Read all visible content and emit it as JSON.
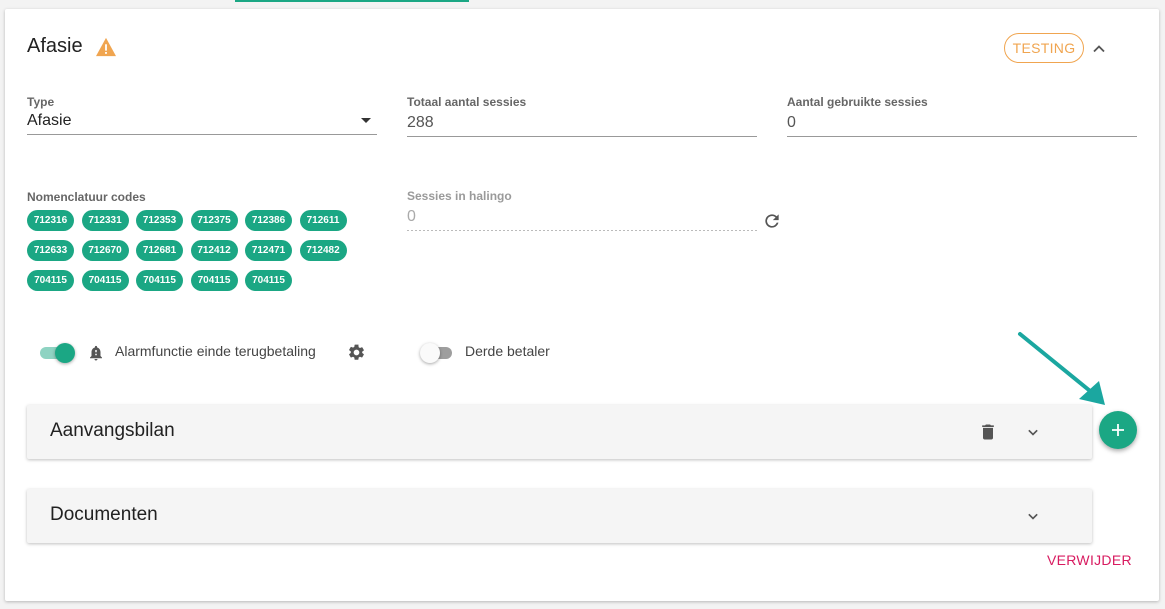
{
  "header": {
    "title": "Afasie",
    "badge": "TESTING"
  },
  "fields": {
    "type": {
      "label": "Type",
      "value": "Afasie"
    },
    "total_sessions": {
      "label": "Totaal aantal sessies",
      "value": "288"
    },
    "used_sessions": {
      "label": "Aantal gebruikte sessies",
      "value": "0"
    },
    "nomenclature": {
      "label": "Nomenclatuur codes"
    },
    "halingo_sessions": {
      "label": "Sessies in halingo",
      "value": "0"
    }
  },
  "codes": [
    "712316",
    "712331",
    "712353",
    "712375",
    "712386",
    "712611",
    "712633",
    "712670",
    "712681",
    "712412",
    "712471",
    "712482",
    "704115",
    "704115",
    "704115",
    "704115",
    "704115"
  ],
  "toggles": {
    "alarm": {
      "label": "Alarmfunctie einde terugbetaling",
      "on": true
    },
    "third_party": {
      "label": "Derde betaler",
      "on": false
    }
  },
  "panels": {
    "aanvangsbilan": "Aanvangsbilan",
    "documenten": "Documenten"
  },
  "actions": {
    "delete_label": "VERWIJDER"
  },
  "colors": {
    "accent": "#1ba784",
    "warning": "#f0a550",
    "danger": "#d81b60"
  },
  "icons": {
    "warning": "warning-icon",
    "collapse": "chevron-up-icon",
    "refresh": "refresh-icon",
    "bell": "bell-icon",
    "settings": "gear-icon",
    "trash": "trash-icon",
    "expand": "chevron-down-icon",
    "add": "plus-icon"
  }
}
